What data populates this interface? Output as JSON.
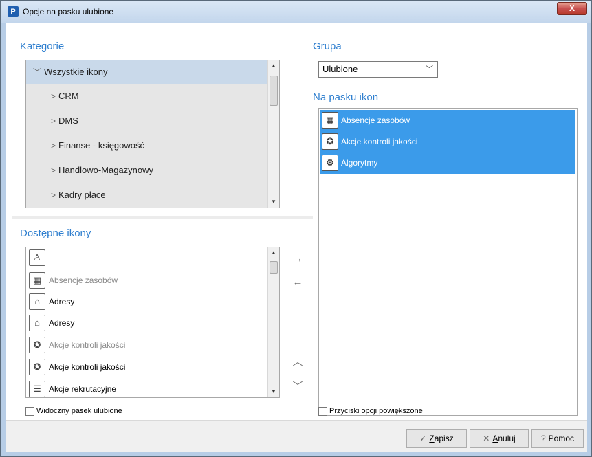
{
  "window": {
    "app_icon": "P",
    "title": "Opcje na pasku ulubione",
    "close_glyph": "X"
  },
  "kategorie": {
    "label": "Kategorie",
    "root": "Wszystkie ikony",
    "items": [
      "CRM",
      "DMS",
      "Finanse - księgowość",
      "Handlowo-Magazynowy",
      "Kadry płace"
    ]
  },
  "grupa": {
    "label": "Grupa",
    "value": "Ulubione"
  },
  "na_pasku": {
    "label": "Na pasku ikon",
    "items": [
      {
        "label": "Absencje zasobów",
        "icon": "calendar-icon"
      },
      {
        "label": "Akcje kontroli jakości",
        "icon": "quality-badge-icon"
      },
      {
        "label": "Algorytmy",
        "icon": "algorithm-icon"
      }
    ]
  },
  "dostepne": {
    "label": "Dostępne ikony",
    "items": [
      {
        "label": "",
        "icon": "user-document-icon",
        "dim": false
      },
      {
        "label": "Absencje zasobów",
        "icon": "calendar-icon",
        "dim": true
      },
      {
        "label": "Adresy",
        "icon": "address-building-icon",
        "dim": false
      },
      {
        "label": "Adresy",
        "icon": "address-building-icon",
        "dim": false
      },
      {
        "label": "Akcje kontroli jakości",
        "icon": "quality-badge-icon",
        "dim": true
      },
      {
        "label": "Akcje kontroli jakości",
        "icon": "quality-badge-icon",
        "dim": false
      },
      {
        "label": "Akcje rekrutacyjne",
        "icon": "recruitment-form-icon",
        "dim": false
      }
    ]
  },
  "arrows": {
    "add": "→",
    "remove": "←",
    "up": "︿",
    "down": "﹀"
  },
  "checkboxes": {
    "visible_bar": {
      "label": "Widoczny pasek ulubione",
      "checked": false
    },
    "enlarged_buttons": {
      "label": "Przyciski opcji powiększone",
      "checked": false
    }
  },
  "buttons": {
    "save": {
      "glyph": "✓",
      "mnemonic": "Z",
      "rest": "apisz"
    },
    "cancel": {
      "glyph": "✕",
      "mnemonic": "A",
      "rest": "nuluj"
    },
    "help": {
      "glyph": "?",
      "label": "Pomoc"
    }
  },
  "colors": {
    "accent_label": "#2f7fcf",
    "selection": "#3b9bea",
    "tree_root_highlight": "#c9d9ea"
  }
}
